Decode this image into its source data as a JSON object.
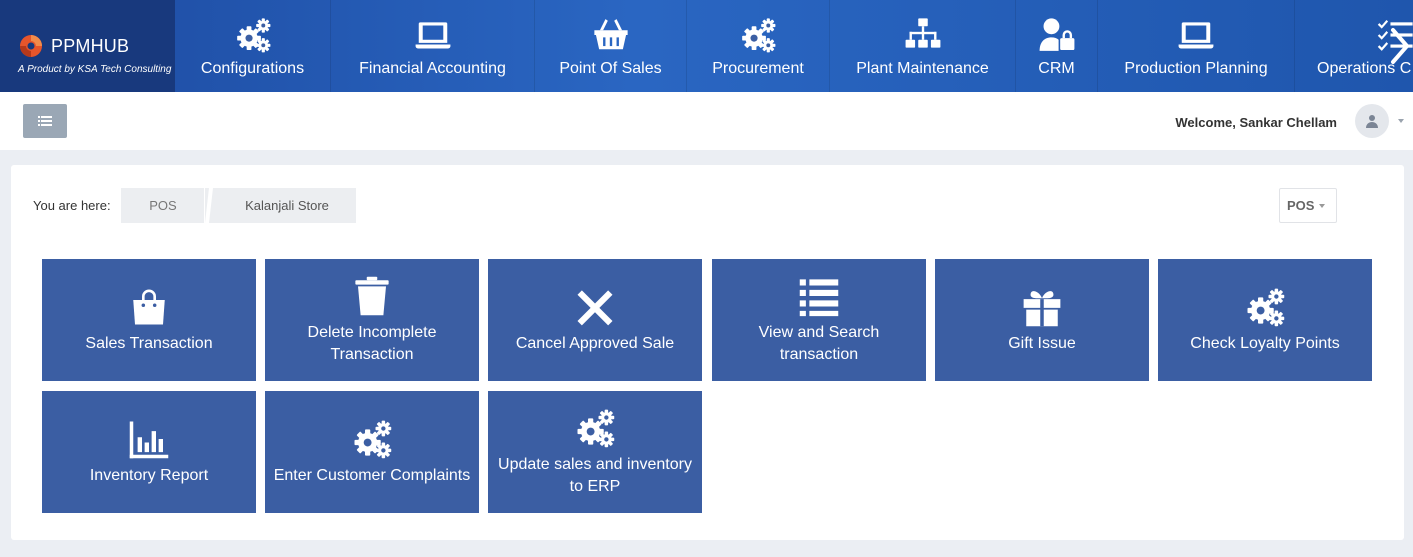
{
  "brand": {
    "name": "PPMHUB",
    "tagline": "A Product by KSA Tech Consulting"
  },
  "nav": [
    {
      "label": "Configurations",
      "icon": "gears-icon"
    },
    {
      "label": "Financial Accounting",
      "icon": "laptop-icon"
    },
    {
      "label": "Point Of Sales",
      "icon": "basket-icon"
    },
    {
      "label": "Procurement",
      "icon": "gears-icon"
    },
    {
      "label": "Plant Maintenance",
      "icon": "sitemap-icon"
    },
    {
      "label": "CRM",
      "icon": "user-lock-icon"
    },
    {
      "label": "Production Planning",
      "icon": "laptop-icon"
    },
    {
      "label": "Operations C",
      "icon": "checklist-icon"
    }
  ],
  "header": {
    "welcome": "Welcome, Sankar Chellam"
  },
  "breadcrumb": {
    "label": "You are here:",
    "items": [
      "POS",
      "Kalanjali Store"
    ]
  },
  "pos_select": {
    "value": "POS"
  },
  "tiles": [
    {
      "label": "Sales Transaction",
      "icon": "shopping-bag-icon"
    },
    {
      "label": "Delete Incomplete Transaction",
      "icon": "trash-icon"
    },
    {
      "label": "Cancel Approved Sale",
      "icon": "close-icon"
    },
    {
      "label": "View and Search transaction",
      "icon": "list-icon"
    },
    {
      "label": "Gift Issue",
      "icon": "gift-icon"
    },
    {
      "label": "Check Loyalty Points",
      "icon": "gears-icon"
    },
    {
      "label": "Inventory Report",
      "icon": "bar-chart-icon"
    },
    {
      "label": "Enter Customer Complaints",
      "icon": "gears-icon"
    },
    {
      "label": "Update sales and inventory to ERP",
      "icon": "gears-icon"
    }
  ],
  "colors": {
    "nav_bg": "#2a66c2",
    "brand_bg": "#18397d",
    "tile_bg": "#3b5ea3",
    "page_bg": "#ebeef3"
  }
}
